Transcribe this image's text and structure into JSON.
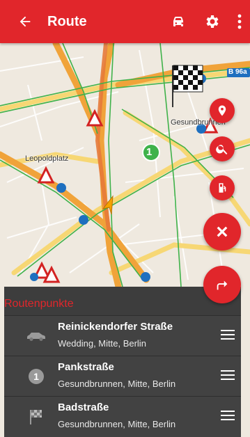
{
  "header": {
    "title": "Route",
    "back_icon": "arrow-back-icon",
    "actions": [
      "car-icon",
      "gear-icon",
      "more-vertical-icon"
    ]
  },
  "map": {
    "labels": {
      "leopoldplatz": "Leopoldplatz",
      "gesundbrunnen": "Gesundbrunnen",
      "road_badge": "B 96a"
    },
    "waypoint_marker": "1",
    "colors": {
      "major_road": "#f0a33a",
      "minor_road": "#f7d774",
      "transit_line": "#3fb24a",
      "route": "#e57a3a"
    }
  },
  "fabs": [
    "location-pin-icon",
    "search-icon",
    "fuel-station-icon",
    "close-icon",
    "turn-right-icon"
  ],
  "route_panel": {
    "title": "Routenpunkte",
    "points": [
      {
        "icon": "car-icon",
        "name": "Reinickendorfer Straße",
        "area": "Wedding, Mitte, Berlin"
      },
      {
        "icon": "waypoint-number-icon",
        "badge": "1",
        "name": "Pankstraße",
        "area": "Gesundbrunnen, Mitte, Berlin"
      },
      {
        "icon": "finish-flag-icon",
        "name": "Badstraße",
        "area": "Gesundbrunnen, Mitte, Berlin"
      }
    ]
  },
  "accent_color": "#e1262b"
}
